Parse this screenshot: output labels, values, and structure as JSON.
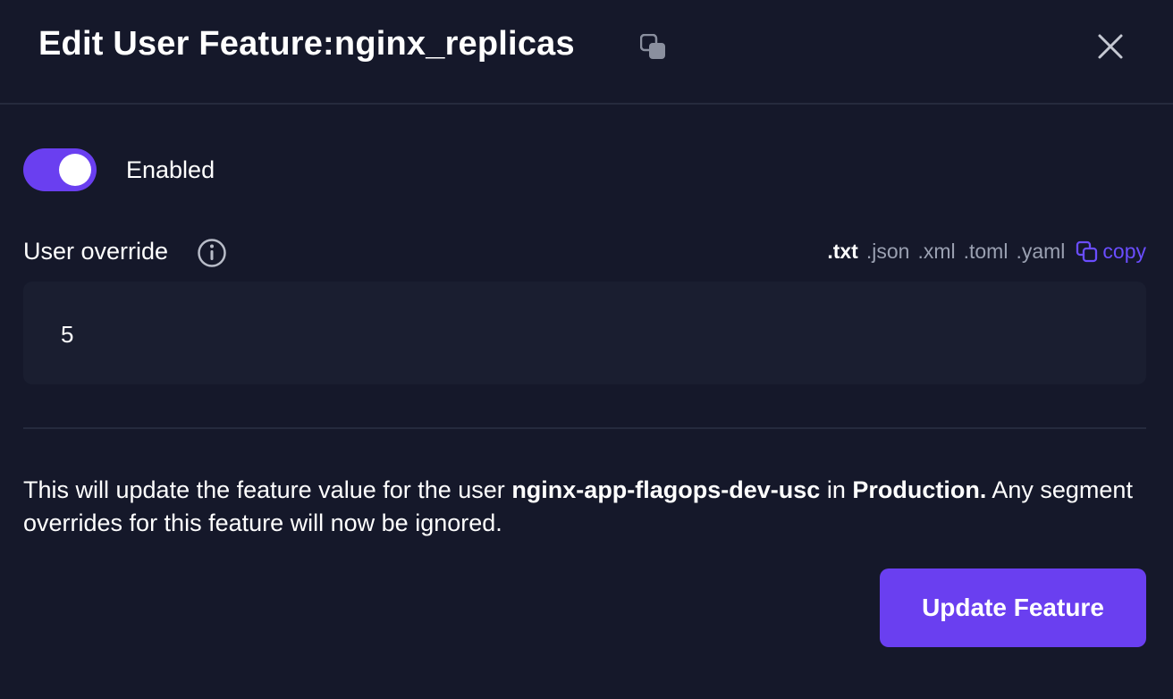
{
  "header": {
    "title": "Edit User Feature:nginx_replicas",
    "copy_icon": "copy-icon",
    "close_icon": "close-icon"
  },
  "toggle": {
    "enabled": true,
    "label": "Enabled"
  },
  "override": {
    "label": "User override",
    "info_icon": "info-icon",
    "formats": [
      ".txt",
      ".json",
      ".xml",
      ".toml",
      ".yaml"
    ],
    "active_format": ".txt",
    "copy_label": "copy",
    "value": "5"
  },
  "message": {
    "part1": "This will update the feature value for the user ",
    "user": "nginx-app-flagops-dev-usc",
    "part2": " in ",
    "environment": "Production.",
    "part3": " Any segment overrides for this feature will now be ignored."
  },
  "actions": {
    "update_label": "Update Feature"
  },
  "colors": {
    "background": "#15182a",
    "accent": "#6a3ff0",
    "input_bg": "#1a1e30",
    "muted_text": "#9aa0b1"
  }
}
